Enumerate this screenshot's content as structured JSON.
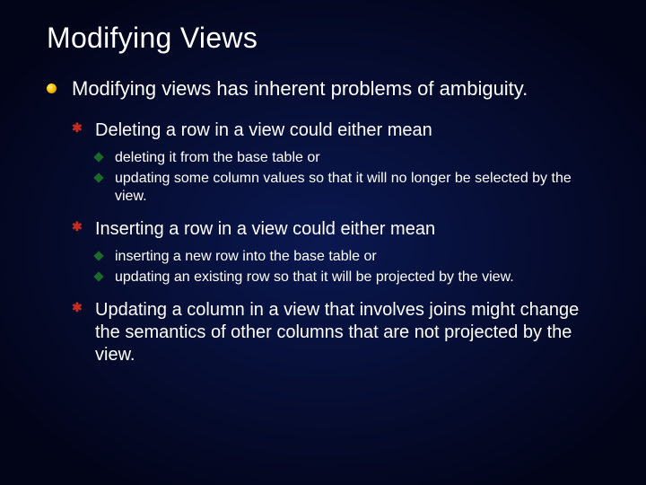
{
  "title": "Modifying Views",
  "lvl1": {
    "item0": "Modifying views has inherent problems of ambiguity."
  },
  "lvl2": {
    "item0": "Deleting a row in a view could either mean",
    "item1": "Inserting a row in a view could either mean",
    "item2": "Updating a column in a view that involves joins might change the semantics of other columns that are not projected by the view."
  },
  "lvl3a": {
    "item0": "deleting it from the base table or",
    "item1": "updating some column values so that it will no longer be selected by the view."
  },
  "lvl3b": {
    "item0": "inserting a new row into the base table or",
    "item1": "updating an existing row so that it will be projected by the view."
  }
}
